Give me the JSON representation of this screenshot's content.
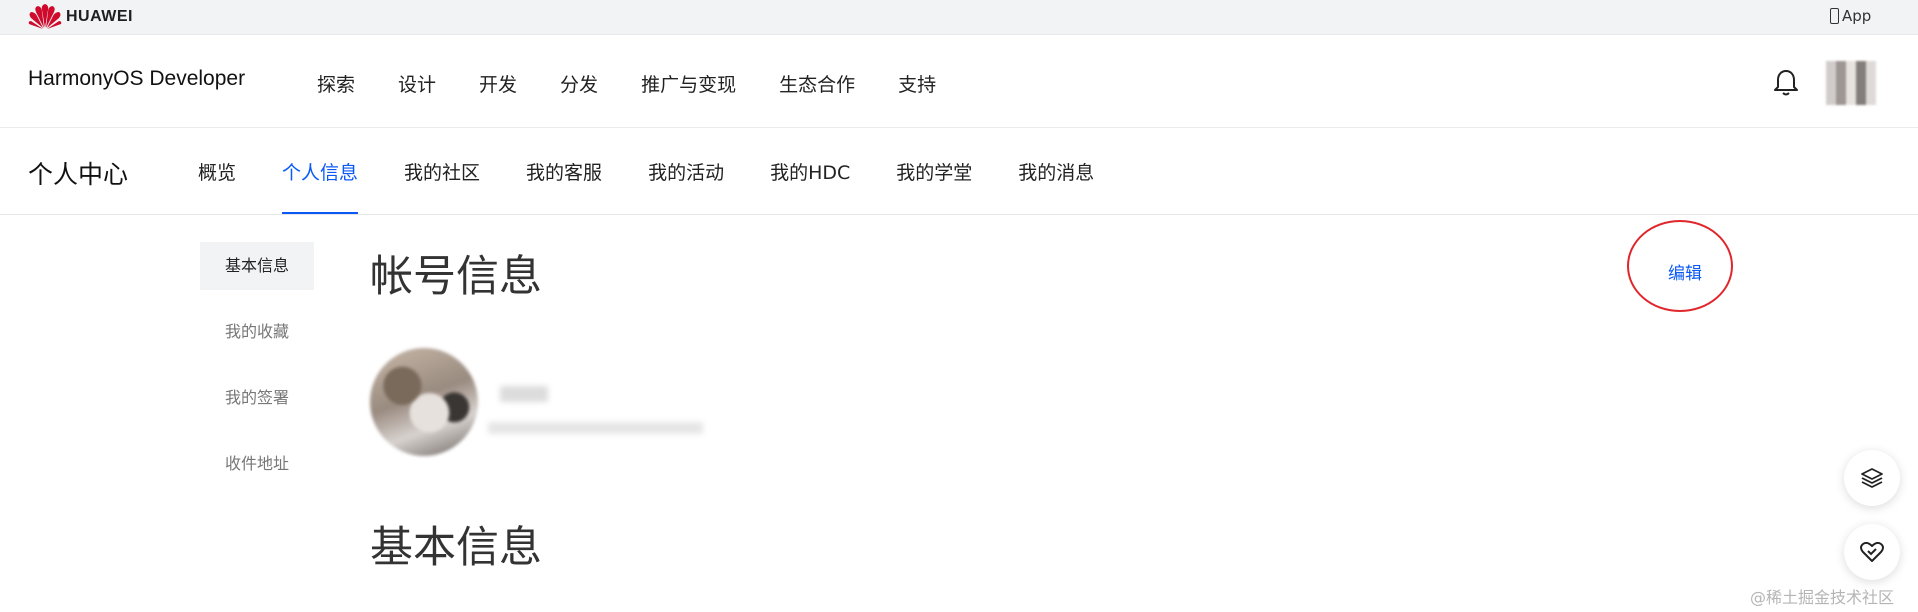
{
  "topbar": {
    "brand": "HUAWEI",
    "app_link": "App"
  },
  "header": {
    "brand": "HarmonyOS Developer",
    "nav": [
      "探索",
      "设计",
      "开发",
      "分发",
      "推广与变现",
      "生态合作",
      "支持"
    ]
  },
  "subnav": {
    "title": "个人中心",
    "tabs": [
      {
        "label": "概览",
        "active": false
      },
      {
        "label": "个人信息",
        "active": true
      },
      {
        "label": "我的社区",
        "active": false
      },
      {
        "label": "我的客服",
        "active": false
      },
      {
        "label": "我的活动",
        "active": false
      },
      {
        "label": "我的HDC",
        "active": false
      },
      {
        "label": "我的学堂",
        "active": false
      },
      {
        "label": "我的消息",
        "active": false
      }
    ]
  },
  "sidebar": {
    "items": [
      {
        "label": "基本信息",
        "active": true
      },
      {
        "label": "我的收藏",
        "active": false
      },
      {
        "label": "我的签署",
        "active": false
      },
      {
        "label": "收件地址",
        "active": false
      }
    ]
  },
  "main": {
    "account_title": "帐号信息",
    "edit_label": "编辑",
    "basic_title": "基本信息"
  },
  "watermark": "@稀土掘金技术社区",
  "colors": {
    "accent": "#0a59f7",
    "huawei_red": "#cf0a2c",
    "annotation_red": "#e0262a"
  },
  "icons": [
    "huawei-logo",
    "phone-icon",
    "bell-icon",
    "layers-icon",
    "heart-icon"
  ]
}
